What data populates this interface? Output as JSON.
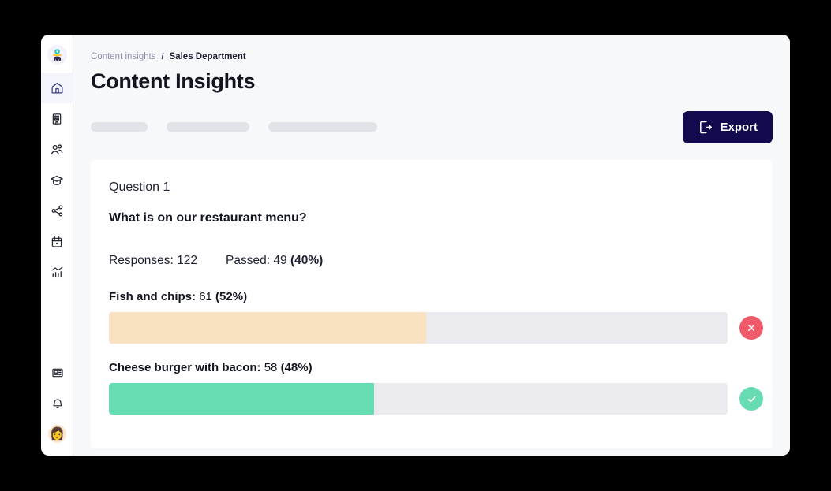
{
  "window": {
    "background": "#f7f8fa"
  },
  "sidebar": {
    "logo": {
      "name": "app-logo",
      "colors": {
        "head": "#2ec4b6",
        "band": "#ffc93c",
        "body": "#2b2a4c"
      }
    },
    "items": [
      {
        "id": "home",
        "icon": "home-icon",
        "label": "Home",
        "active": true
      },
      {
        "id": "organization",
        "icon": "building-icon",
        "label": "Organization",
        "active": false
      },
      {
        "id": "people",
        "icon": "users-icon",
        "label": "People",
        "active": false
      },
      {
        "id": "learning",
        "icon": "graduation-cap-icon",
        "label": "Learning",
        "active": false
      },
      {
        "id": "share",
        "icon": "share-network-icon",
        "label": "Share",
        "active": false
      },
      {
        "id": "calendar",
        "icon": "calendar-icon",
        "label": "Calendar",
        "active": false
      },
      {
        "id": "insights",
        "icon": "chart-analytics-icon",
        "label": "Insights",
        "active": false
      }
    ],
    "bottom_items": [
      {
        "id": "news",
        "icon": "newspaper-icon",
        "label": "News"
      },
      {
        "id": "notifications",
        "icon": "bell-icon",
        "label": "Notifications"
      },
      {
        "id": "profile",
        "icon": "avatar-icon",
        "label": "Profile",
        "emoji": "👩"
      }
    ]
  },
  "breadcrumb": {
    "parent": "Content insights",
    "separator": "/",
    "current": "Sales Department"
  },
  "header": {
    "title": "Content Insights",
    "skeletons": [
      72,
      105,
      138
    ],
    "export": {
      "label": "Export",
      "icon": "file-export-icon",
      "background": "#120a4f",
      "text_color": "#ffffff"
    }
  },
  "card": {
    "question_label": "Question 1",
    "question_text": "What is on our restaurant menu?",
    "stats": {
      "responses_label": "Responses:",
      "responses_value": "122",
      "passed_label": "Passed:",
      "passed_value": "49",
      "passed_percent": "(40%)"
    },
    "answers": [
      {
        "name": "Fish and chips:",
        "count": "61",
        "percent": "(52%)",
        "fill_ratio": 0.513,
        "fill_color": "#f9e2c2",
        "track_color": "#eaeaef",
        "status": "incorrect",
        "status_icon": "x-circle-icon",
        "status_color": "#ef5a6b"
      },
      {
        "name": "Cheese burger with bacon:",
        "count": "58",
        "percent": "(48%)",
        "fill_ratio": 0.428,
        "fill_color": "#67dbb1",
        "track_color": "#eaeaef",
        "status": "correct",
        "status_icon": "check-circle-icon",
        "status_color": "#67dbb1"
      }
    ]
  },
  "chart_data": {
    "type": "bar",
    "title": "What is on our restaurant menu?",
    "categories": [
      "Fish and chips",
      "Cheese burger with bacon"
    ],
    "values": [
      61,
      58
    ],
    "percentages": [
      52,
      48
    ],
    "statuses": [
      "incorrect",
      "correct"
    ],
    "total_responses": 122,
    "passed": 49,
    "passed_percent": 40,
    "xlabel": "",
    "ylabel": "Responses",
    "orientation": "horizontal",
    "grid": false,
    "legend": "none"
  }
}
